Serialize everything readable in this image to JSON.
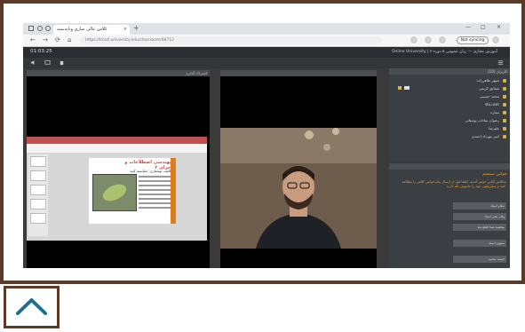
{
  "browser": {
    "tab_title": "کلاس عالی سازی ونابه‌نمبه",
    "tab_close": "×",
    "new_tab": "+",
    "url": "https://lms4.university.edu/classroom/48712",
    "work_button": "Not syncing",
    "window_controls": [
      "—",
      "□",
      "×"
    ],
    "nav": [
      "←",
      "→",
      "⟳",
      "⌂"
    ]
  },
  "app": {
    "time": "01:03:25",
    "title": "Online University | آموزش مجازی — زبان عمومی ۵ دوره ۲"
  },
  "panes": {
    "presentation_header": "اشتراک گذاری",
    "camera_header": "",
    "users_header": "کاربران (10)",
    "chat_header": ""
  },
  "slide": {
    "title": "مهندسی اصطلاحات و اجزای ۲",
    "subtitle": "تکلیف نوشتاری: مقایسه کنید"
  },
  "users": [
    "سپهر طاهرزاده",
    "شقایق کریمی",
    "محمد حسینی",
    "stu.user",
    "ستاره",
    "رضوان سادات بوستانی",
    "علیرضا",
    "امیر مهرداد احمدی"
  ],
  "chat": {
    "notice_title": "قوانین سیستم",
    "notice_text": "به‌کلاس آنلاین خوش آمدید. لطفا قبل از ارسال پیام قوانین کلاس را مطالعه کنید و میکروفون خود را خاموش نگه دارید.",
    "messages": [
      "سلام استاد",
      "وقت بخیر استاد",
      "ببخشید صدا قطع شد",
      "ممنون استاد",
      "خسته نباشید"
    ]
  },
  "colors": {
    "frame_border": "#5a3b2a",
    "accent_orange": "#e6a135",
    "up_arrow": "#1f6f8b"
  },
  "scroll_up_icon": "chevron-up-icon"
}
